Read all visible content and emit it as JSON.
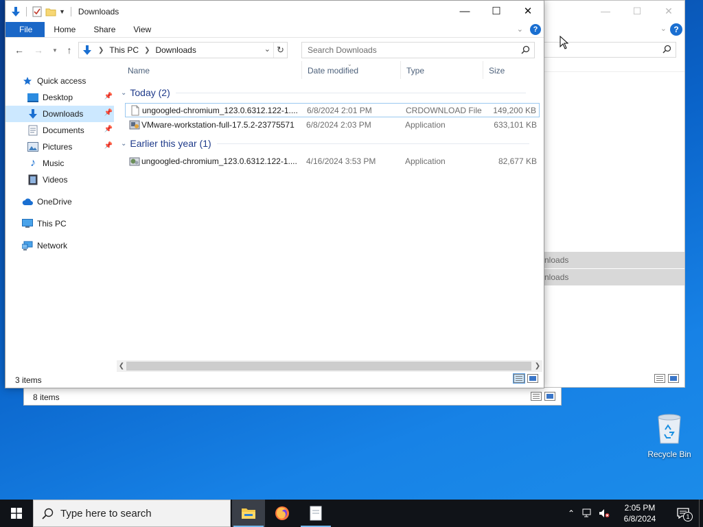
{
  "main_window": {
    "title": "Downloads",
    "ribbon_tabs": [
      "File",
      "Home",
      "Share",
      "View"
    ],
    "help_glyph": "?",
    "address": {
      "crumbs": [
        "This PC",
        "Downloads"
      ]
    },
    "search_placeholder": "Search Downloads",
    "nav_pane": {
      "items": [
        {
          "label": "Quick access",
          "icon": "star-icon"
        },
        {
          "label": "Desktop",
          "icon": "desktop-folder-icon",
          "pinned": true
        },
        {
          "label": "Downloads",
          "icon": "download-arrow-icon",
          "pinned": true,
          "selected": true
        },
        {
          "label": "Documents",
          "icon": "documents-icon",
          "pinned": true
        },
        {
          "label": "Pictures",
          "icon": "pictures-icon",
          "pinned": true
        },
        {
          "label": "Music",
          "icon": "music-note-icon"
        },
        {
          "label": "Videos",
          "icon": "videos-icon"
        },
        {
          "label": "OneDrive",
          "icon": "cloud-icon"
        },
        {
          "label": "This PC",
          "icon": "computer-icon"
        },
        {
          "label": "Network",
          "icon": "network-icon"
        }
      ]
    },
    "columns": [
      "Name",
      "Date modified",
      "Type",
      "Size"
    ],
    "groups": [
      {
        "title": "Today (2)",
        "files": [
          {
            "name": "ungoogled-chromium_123.0.6312.122-1....",
            "date": "6/8/2024 2:01 PM",
            "type": "CRDOWNLOAD File",
            "size": "149,200 KB",
            "icon": "blank-file-icon"
          },
          {
            "name": "VMware-workstation-full-17.5.2-23775571",
            "date": "6/8/2024 2:03 PM",
            "type": "Application",
            "size": "633,101 KB",
            "icon": "vmware-installer-icon"
          }
        ]
      },
      {
        "title": "Earlier this year (1)",
        "files": [
          {
            "name": "ungoogled-chromium_123.0.6312.122-1....",
            "date": "4/16/2024 3:53 PM",
            "type": "Application",
            "size": "82,677 KB",
            "icon": "installer-app-icon"
          }
        ]
      }
    ],
    "status": "3 items"
  },
  "background_window_right": {
    "help_glyph": "?",
    "nav_rows": [
      "nloads",
      "nloads"
    ]
  },
  "background_window_bottom": {
    "status": "8 items"
  },
  "desktop": {
    "recycle_bin_label": "Recycle Bin"
  },
  "taskbar": {
    "search_placeholder": "Type here to search",
    "apps": [
      "file-explorer-icon",
      "firefox-icon",
      "notepad-icon"
    ],
    "time": "2:05 PM",
    "date": "6/8/2024",
    "notification_count": "1"
  },
  "colors": {
    "accent": "#1a67c7",
    "selection": "#cce8ff",
    "group_title": "#1e3a8a",
    "taskbar": "#101318"
  }
}
